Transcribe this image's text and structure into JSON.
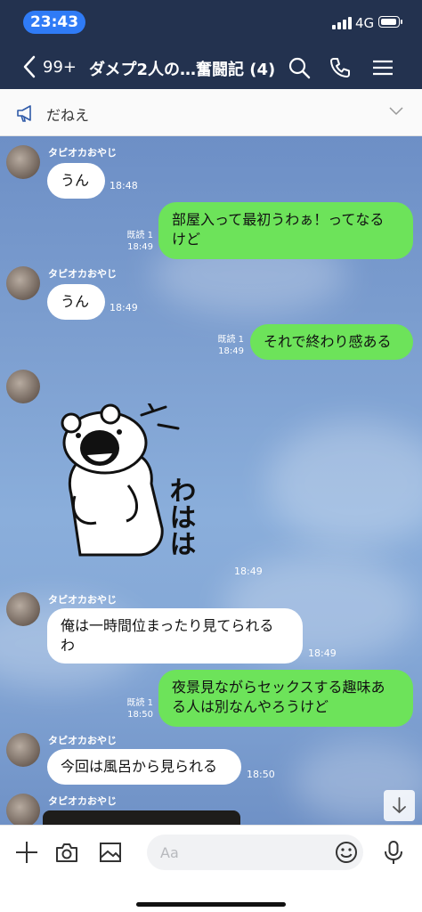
{
  "status_bar": {
    "time": "23:43",
    "network": "4G"
  },
  "header": {
    "back_count": "99+",
    "title": "ダメプ2人の…奮闘記 (4)",
    "background": "#23324f"
  },
  "announcement": {
    "text": "だねえ"
  },
  "messages": [
    {
      "sender": "タピオカおやじ",
      "text": "うん",
      "time": "18:48"
    },
    {
      "text": "部屋入って最初うわぁ！ってなるけど",
      "line1": "部屋入って最初うわぁ！ってなる",
      "line2": "けど",
      "read": "既読 1",
      "time": "18:49"
    },
    {
      "sender": "タピオカおやじ",
      "text": "うん",
      "time": "18:49"
    },
    {
      "text": "それで終わり感ある",
      "read": "既読 1",
      "time": "18:49"
    },
    {
      "sender": "タピオカおやじ",
      "sticker_text": "わはは",
      "time": "18:49"
    },
    {
      "sender": "タピオカおやじ",
      "line1": "俺は一時間位まったり見てられる",
      "line2": "わ",
      "time": "18:49"
    },
    {
      "line1": "夜景見ながらセックスする趣味あ",
      "line2": "る人は別なんやろうけど",
      "read": "既読 1",
      "time": "18:50"
    },
    {
      "sender": "タピオカおやじ",
      "text": "今回は風呂から見られる",
      "time": "18:50"
    },
    {
      "sender": "タピオカおやじ"
    }
  ],
  "input": {
    "placeholder": "Aa"
  },
  "icons": {
    "back": "chevron-left-icon",
    "search": "search-icon",
    "call": "phone-icon",
    "menu": "menu-icon",
    "announce": "megaphone-icon",
    "expand": "chevron-down-icon",
    "scroll": "arrow-down-icon",
    "add": "plus-icon",
    "camera": "camera-icon",
    "image": "image-icon",
    "emoji": "emoji-icon",
    "mic": "microphone-icon"
  },
  "colors": {
    "outgoing_bubble": "#6de35a",
    "incoming_bubble": "#ffffff",
    "time_pill": "#2f7bf6"
  }
}
